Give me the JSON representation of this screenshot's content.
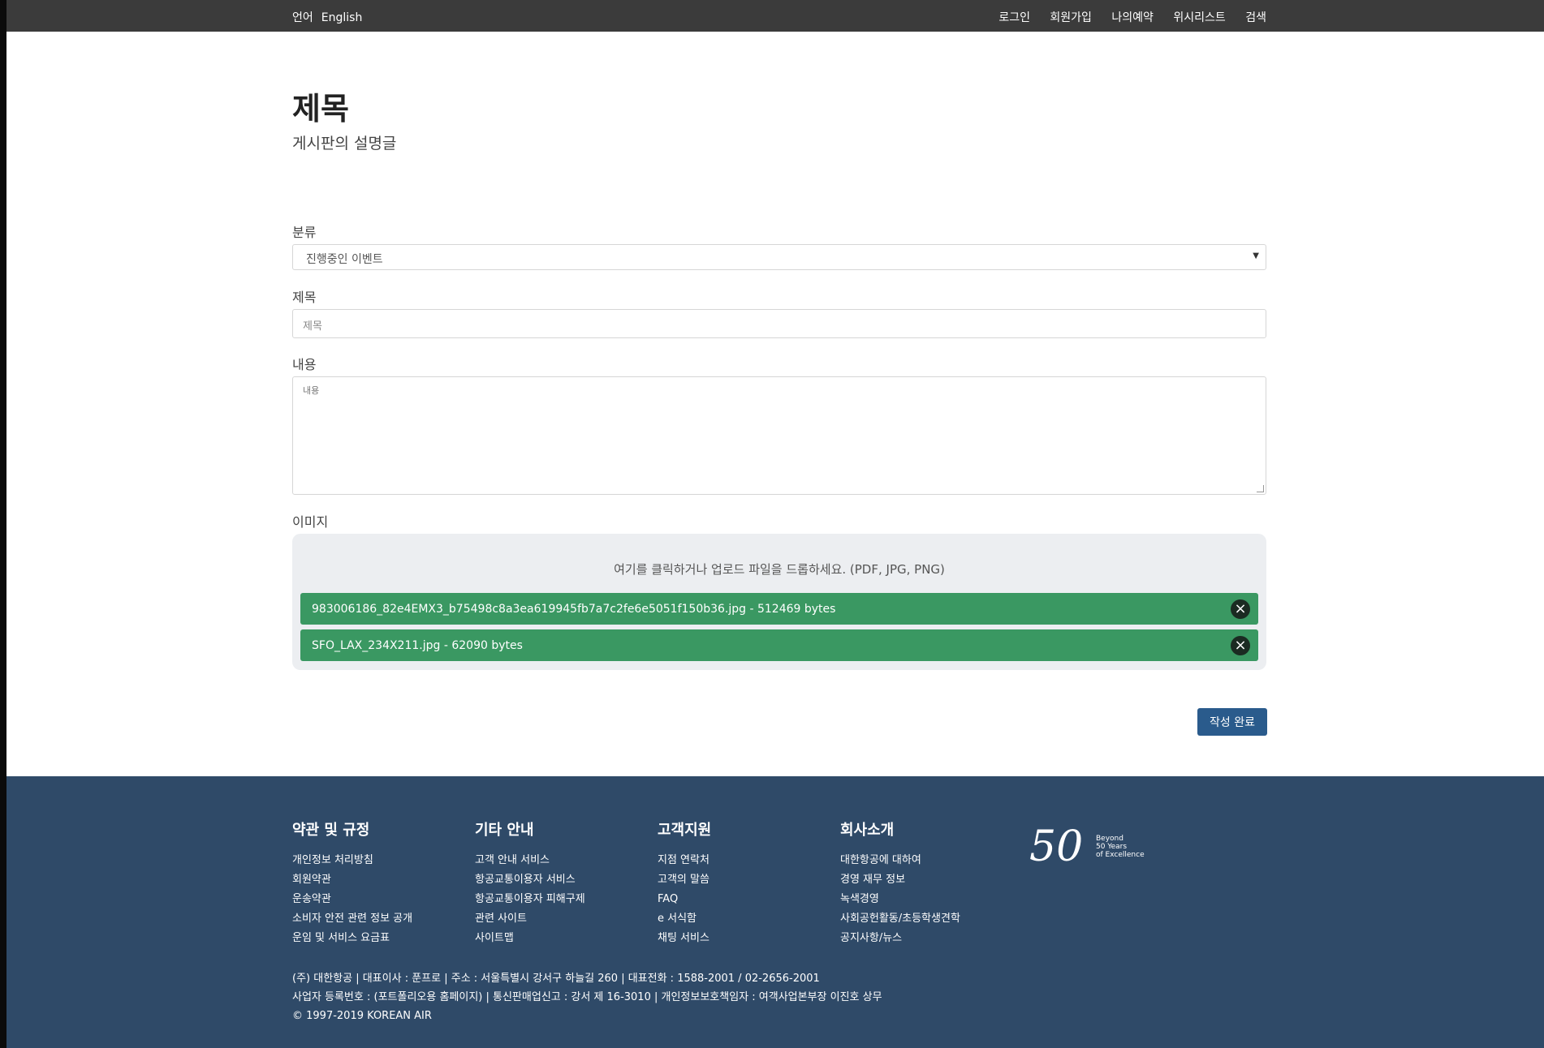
{
  "topbar": {
    "lang_label": "언어",
    "lang_value": "English",
    "nav": [
      "로그인",
      "회원가입",
      "나의예약",
      "위시리스트",
      "검색"
    ]
  },
  "header": {
    "title": "제목",
    "description": "게시판의 설명글"
  },
  "form": {
    "category_label": "분류",
    "category_value": "진행중인 이벤트",
    "title_label": "제목",
    "title_placeholder": "제목",
    "content_label": "내용",
    "content_placeholder": "내용",
    "image_label": "이미지",
    "dropzone_message": "여기를 클릭하거나 업로드 파일을 드롭하세요. (PDF, JPG, PNG)",
    "files": [
      "983006186_82e4EMX3_b75498c8a3ea619945fb7a7c2fe6e5051f150b36.jpg - 512469 bytes",
      "SFO_LAX_234X211.jpg - 62090 bytes"
    ],
    "submit_label": "작성 완료"
  },
  "footer": {
    "columns": [
      {
        "title": "약관 및 규정",
        "links": [
          "개인정보 처리방침",
          "회원약관",
          "운송약관",
          "소비자 안전 관련 정보 공개",
          "운임 및 서비스 요금표"
        ]
      },
      {
        "title": "기타 안내",
        "links": [
          "고객 안내 서비스",
          "항공교통이용자 서비스",
          "항공교통이용자 피해구제",
          "관련 사이트",
          "사이트맵"
        ]
      },
      {
        "title": "고객지원",
        "links": [
          "지점 연락처",
          "고객의 말씀",
          "FAQ",
          "e 서식함",
          "채팅 서비스"
        ]
      },
      {
        "title": "회사소개",
        "links": [
          "대한항공에 대하여",
          "경영 재무 정보",
          "녹색경영",
          "사회공헌활동/초등학생견학",
          "공지사항/뉴스"
        ]
      }
    ],
    "logo_number": "50",
    "logo_tagline": [
      "Beyond",
      "50 Years",
      "of Excellence"
    ],
    "info_lines": [
      "(주) 대한항공 | 대표이사 : 푼프로 | 주소 : 서울특별시 강서구 하늘길 260 | 대표전화 : 1588-2001 / 02-2656-2001",
      "사업자 등록번호 : (포트폴리오용 홈페이지) | 통신판매업신고 : 강서 제 16-3010 | 개인정보보호책임자 : 여객사업본부장 이진호 상무",
      "© 1997-2019 KOREAN AIR"
    ],
    "colors": {
      "background": "#2f4a68",
      "file_row": "#3a9862",
      "submit": "#2a5b8c"
    }
  }
}
